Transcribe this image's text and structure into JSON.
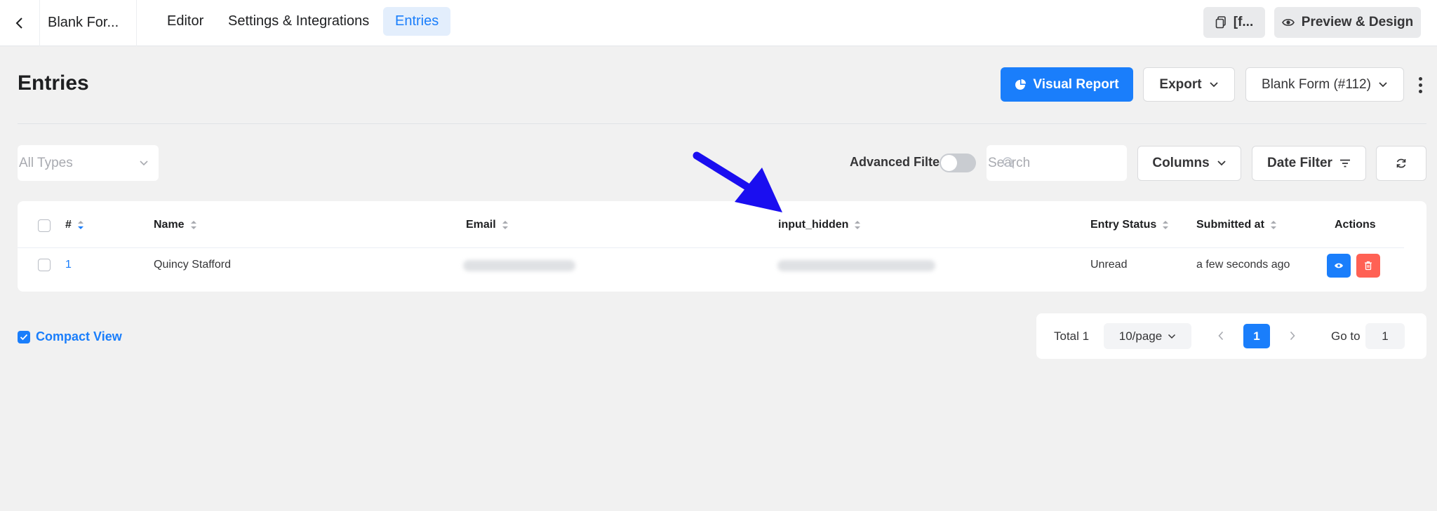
{
  "topbar": {
    "form_name": "Blank For...",
    "tabs": [
      {
        "label": "Editor"
      },
      {
        "label": "Settings & Integrations"
      },
      {
        "label": "Entries"
      }
    ],
    "shortcode_label": "[f...",
    "preview_label": "Preview & Design"
  },
  "header": {
    "title": "Entries",
    "visual_report_label": "Visual Report",
    "export_label": "Export",
    "form_select_label": "Blank Form (#112)"
  },
  "filters": {
    "types_placeholder": "All Types",
    "advanced_filter_label": "Advanced Filter",
    "search_placeholder": "Search",
    "columns_label": "Columns",
    "date_filter_label": "Date Filter"
  },
  "table": {
    "columns": [
      "#",
      "Name",
      "Email",
      "input_hidden",
      "Entry Status",
      "Submitted at",
      "Actions"
    ],
    "rows": [
      {
        "id": "1",
        "name": "Quincy Stafford",
        "status": "Unread",
        "submitted": "a few seconds ago"
      }
    ]
  },
  "footer": {
    "compact_view_label": "Compact View",
    "total_label": "Total 1",
    "page_size_label": "10/page",
    "current_page": "1",
    "goto_label": "Go to",
    "goto_value": "1"
  },
  "colors": {
    "accent": "#1a7efb",
    "danger": "#ff6154",
    "annotation_arrow": "#1a0ef0"
  }
}
